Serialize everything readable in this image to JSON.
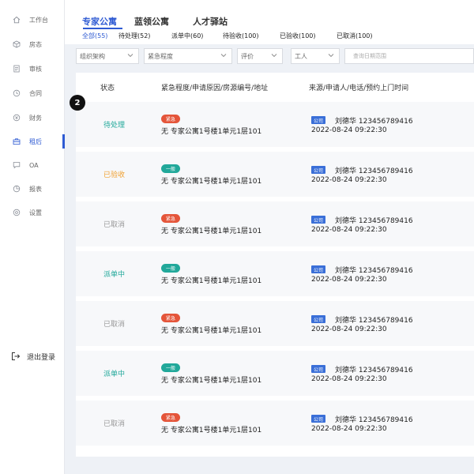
{
  "sidebar": {
    "items": [
      {
        "label": "工作台",
        "icon": "home-icon"
      },
      {
        "label": "房态",
        "icon": "cube-icon"
      },
      {
        "label": "审核",
        "icon": "document-icon"
      },
      {
        "label": "合同",
        "icon": "clock-icon"
      },
      {
        "label": "财务",
        "icon": "money-icon"
      },
      {
        "label": "租后",
        "icon": "briefcase-icon"
      },
      {
        "label": "OA",
        "icon": "chat-icon"
      },
      {
        "label": "报表",
        "icon": "chart-icon"
      },
      {
        "label": "设置",
        "icon": "gear-icon"
      }
    ],
    "active_index": 5,
    "logout_label": "退出登录"
  },
  "top_tabs": [
    {
      "label": "专家公寓",
      "active": true
    },
    {
      "label": "蓝领公寓",
      "active": false
    },
    {
      "label": "人才驿站",
      "active": false
    }
  ],
  "sub_tabs": [
    {
      "label": "全部(55)",
      "active": true
    },
    {
      "label": "待处理(52)",
      "active": false
    },
    {
      "label": "派单中(60)",
      "active": false
    },
    {
      "label": "待验收(100)",
      "active": false
    },
    {
      "label": "已验收(100)",
      "active": false
    },
    {
      "label": "已取消(100)",
      "active": false
    }
  ],
  "filters": {
    "org": "组织架构",
    "urgency": "紧急程度",
    "rating": "评价",
    "worker": "工人",
    "date_placeholder": "查询日期范围"
  },
  "table": {
    "headers": [
      "状态",
      "紧急程度/申请原因/房源编号/地址",
      "来源/申请人/电话/预约上门时间"
    ],
    "rows": [
      {
        "status": "待处理",
        "status_color": "#21a89a",
        "urgency": "紧急",
        "urgency_type": "urgent",
        "detail": "无  专家公寓1号楼1单元1层101",
        "source": "公司",
        "person": "刘德华  123456789416",
        "time": "2022-08-24  09:22:30"
      },
      {
        "status": "已验收",
        "status_color": "#f0a030",
        "urgency": "一般",
        "urgency_type": "normal",
        "detail": "无  专家公寓1号楼1单元1层101",
        "source": "公司",
        "person": "刘德华  123456789416",
        "time": "2022-08-24  09:22:30"
      },
      {
        "status": "已取消",
        "status_color": "#999999",
        "urgency": "紧急",
        "urgency_type": "urgent",
        "detail": "无  专家公寓1号楼1单元1层101",
        "source": "公司",
        "person": "刘德华  123456789416",
        "time": "2022-08-24  09:22:30"
      },
      {
        "status": "派单中",
        "status_color": "#21a89a",
        "urgency": "一般",
        "urgency_type": "normal",
        "detail": "无  专家公寓1号楼1单元1层101",
        "source": "公司",
        "person": "刘德华  123456789416",
        "time": "2022-08-24  09:22:30"
      },
      {
        "status": "已取消",
        "status_color": "#999999",
        "urgency": "紧急",
        "urgency_type": "urgent",
        "detail": "无  专家公寓1号楼1单元1层101",
        "source": "公司",
        "person": "刘德华  123456789416",
        "time": "2022-08-24  09:22:30"
      },
      {
        "status": "派单中",
        "status_color": "#21a89a",
        "urgency": "一般",
        "urgency_type": "normal",
        "detail": "无  专家公寓1号楼1单元1层101",
        "source": "公司",
        "person": "刘德华  123456789416",
        "time": "2022-08-24  09:22:30"
      },
      {
        "status": "已取消",
        "status_color": "#999999",
        "urgency": "紧急",
        "urgency_type": "urgent",
        "detail": "无  专家公寓1号楼1单元1层101",
        "source": "公司",
        "person": "刘德华  123456789416",
        "time": "2022-08-24  09:22:30"
      }
    ]
  },
  "annotation_marker": "2",
  "colors": {
    "accent": "#2f5bd3",
    "urgent": "#e4553a",
    "normal": "#21a89a",
    "source_tag": "#3a6fd8"
  }
}
